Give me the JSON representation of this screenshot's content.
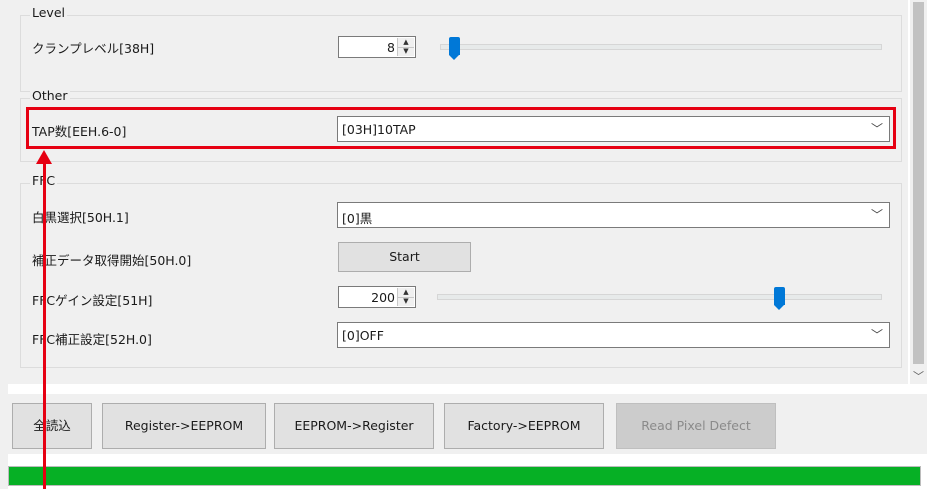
{
  "groups": {
    "level": {
      "title": "Level"
    },
    "other": {
      "title": "Other"
    },
    "ffc": {
      "title": "FFC"
    }
  },
  "level": {
    "clamp_label": "クランプレベル[38H]",
    "clamp_value": "8",
    "clamp_slider_fraction": 0.02
  },
  "other": {
    "tap_label": "TAP数[EEH.6-0]",
    "tap_value": "[03H]10TAP"
  },
  "ffc": {
    "white_black_label": "白黒選択[50H.1]",
    "white_black_value": "[0]黒",
    "acquire_label": "補正データ取得開始[50H.0]",
    "start_label": "Start",
    "gain_label": "FFCゲイン設定[51H]",
    "gain_value": "200",
    "gain_slider_fraction": 0.78,
    "correction_label": "FFC補正設定[52H.0]",
    "correction_value": "[0]OFF"
  },
  "buttons": {
    "read_all": "全読込",
    "register_to_eeprom": "Register->EEPROM",
    "eeprom_to_register": "EEPROM->Register",
    "factory_to_eeprom": "Factory->EEPROM",
    "read_pixel_defect": "Read Pixel Defect"
  },
  "progress": {
    "fraction": 1.0,
    "color": "#06b025"
  },
  "icons": {
    "spin_up": "▲",
    "spin_down": "▼",
    "dropdown": "﹀",
    "scroll_down": "﹀"
  },
  "colors": {
    "highlight": "#e60012",
    "slider_thumb": "#0078d7"
  }
}
